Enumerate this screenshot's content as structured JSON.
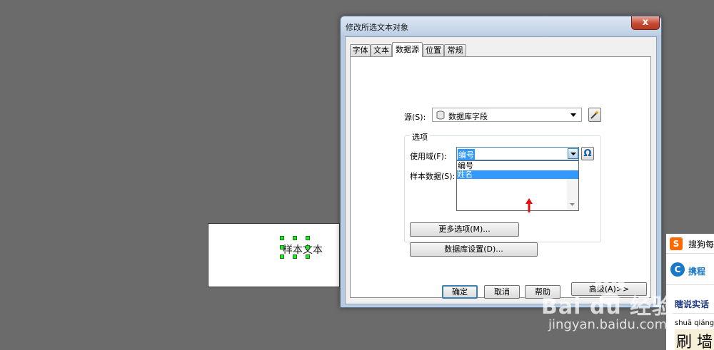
{
  "dialog": {
    "title": "修改所选文本对象",
    "close_glyph": "x",
    "tabs": [
      {
        "label": "字体",
        "active": false
      },
      {
        "label": "文本",
        "active": false
      },
      {
        "label": "数据源",
        "active": true
      },
      {
        "label": "位置",
        "active": false
      },
      {
        "label": "常规",
        "active": false
      }
    ],
    "source_label": "源(S):",
    "source_value": "数据库字段",
    "options_group": "选项",
    "field_label": "使用域(F):",
    "field_value": "编号",
    "field_options": [
      "编号",
      "姓名"
    ],
    "field_highlighted": "姓名",
    "sample_label": "样本数据(S):",
    "more_options_button": "更多选项(M)...",
    "db_settings_button": "数据库设置(D)...",
    "advanced_button": "高级(A)>>",
    "ok_button": "确定",
    "cancel_button": "取消",
    "help_button": "帮助",
    "omega_glyph": "Ω"
  },
  "canvas": {
    "sample_text": "样本文本"
  },
  "side_panel": {
    "rows": [
      {
        "icon": "S",
        "text": "搜狗每"
      },
      {
        "icon": "C",
        "text": "携程"
      },
      {
        "icon": "",
        "text": "瞎说实话"
      }
    ],
    "pinyin": "shuā qiáng",
    "chars": "刷 墙"
  },
  "watermark": {
    "brand": "Bai du 经验",
    "url": "jingyan.baidu.com"
  },
  "colors": {
    "selection": "#3399ff",
    "dialog_frame": "#b9cbe0",
    "arrow": "#e01010",
    "handle": "#2ee62e"
  }
}
